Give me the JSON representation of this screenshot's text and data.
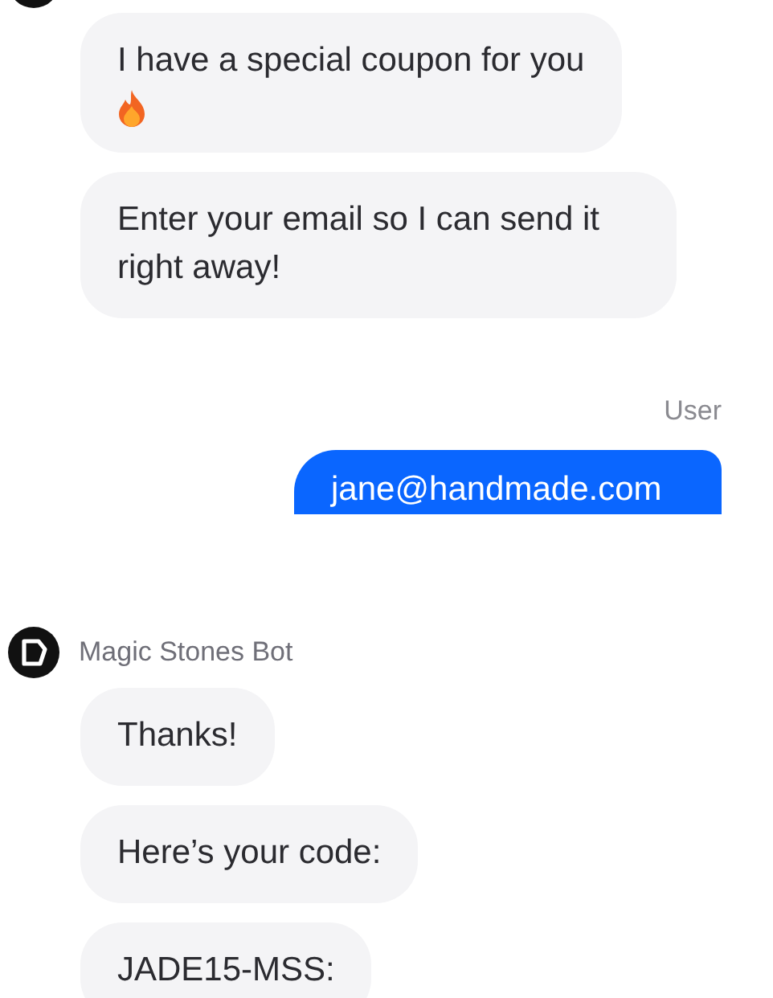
{
  "groups": [
    {
      "kind": "bot",
      "messages": [
        {
          "kind": "text_icon",
          "text": "I have a special coupon for you"
        },
        {
          "kind": "text",
          "text": "Enter your email so I can send it right away!"
        }
      ]
    },
    {
      "kind": "user",
      "label": "User",
      "messages": [
        {
          "text": "jane@handmade.com"
        }
      ]
    },
    {
      "kind": "bot",
      "name": "Magic Stones Bot",
      "messages": [
        {
          "kind": "text",
          "text": "Thanks!"
        },
        {
          "kind": "text",
          "text": "Here’s your code:"
        },
        {
          "kind": "text",
          "text": "JADE15-MSS:"
        }
      ]
    }
  ]
}
